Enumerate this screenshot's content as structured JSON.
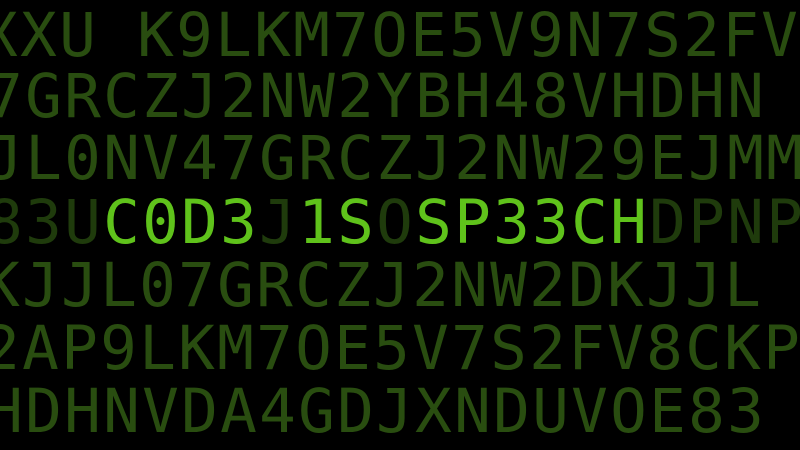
{
  "colors": {
    "background": "#000000",
    "dim": "#294d10",
    "mid": "#1f3b0c",
    "highlight": "#5fc21b"
  },
  "rows": [
    {
      "text": "XXU K9LKM7OE5V9N7S2FV",
      "highlight_indices": []
    },
    {
      "text": "7GRCZJ2NW2YBH48VHDHN",
      "highlight_indices": []
    },
    {
      "text": "JL0NV47GRCZJ2NW29EJMM",
      "highlight_indices": []
    },
    {
      "text": "83UC0D3J1SOSP33CHDPNP",
      "highlight_indices": [
        3,
        4,
        5,
        6,
        8,
        9,
        11,
        12,
        13,
        14,
        15,
        16
      ]
    },
    {
      "text": "KJJL07GRCZJ2NW2DKJJL",
      "highlight_indices": []
    },
    {
      "text": "2AP9LKM7OE5V7S2FV8CKP",
      "highlight_indices": []
    },
    {
      "text": "HDHNVDA4GDJXNDUVOE83",
      "highlight_indices": []
    }
  ],
  "message": "C0D3 1S SP33CH"
}
